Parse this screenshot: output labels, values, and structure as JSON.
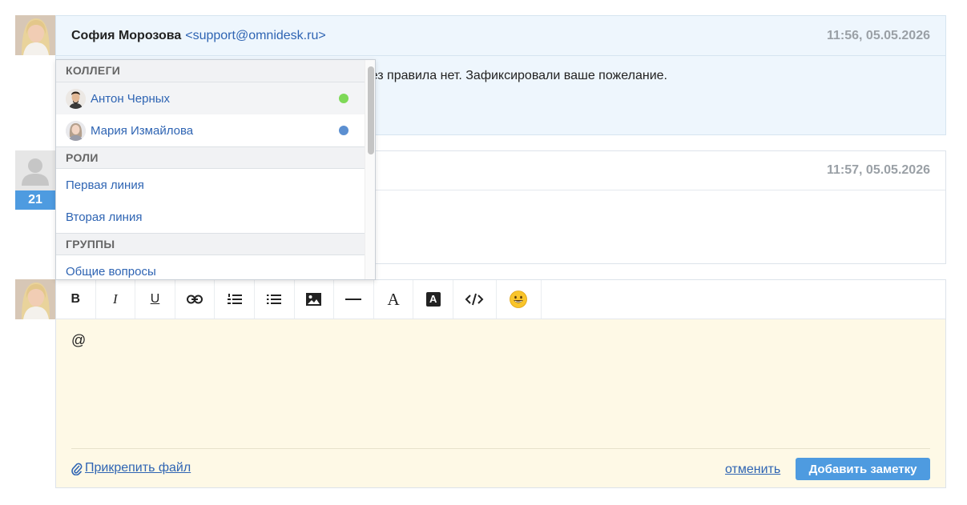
{
  "messages": [
    {
      "sender": "София Морозова",
      "email": "<support@omnidesk.ru>",
      "time": "11:56, 05.05.2026",
      "body_fragment": "ного через правила нет. Зафиксировали ваше пожелание."
    },
    {
      "time": "11:57, 05.05.2026",
      "badge": "21"
    }
  ],
  "dropdown": {
    "sections": [
      {
        "title": "КОЛЛЕГИ",
        "items": [
          {
            "label": "Антон Черных",
            "status_color": "#7ed957"
          },
          {
            "label": "Мария Измайлова",
            "status_color": "#5b8fd1"
          }
        ]
      },
      {
        "title": "РОЛИ",
        "items": [
          {
            "label": "Первая линия"
          },
          {
            "label": "Вторая линия"
          }
        ]
      },
      {
        "title": "ГРУППЫ",
        "items": [
          {
            "label": "Общие вопросы"
          }
        ]
      }
    ]
  },
  "toolbar": {
    "buttons": [
      "bold-icon",
      "italic-icon",
      "underline-icon",
      "link-icon",
      "ordered-list-icon",
      "bullet-list-icon",
      "image-icon",
      "horizontal-rule-icon",
      "font-color-icon",
      "background-color-icon",
      "code-icon",
      "emoji-icon"
    ],
    "bold_label": "B",
    "italic_label": "I",
    "underline_label": "U",
    "font_label": "A",
    "bg_label": "A"
  },
  "editor": {
    "value": "@",
    "attach_label": "Прикрепить файл",
    "cancel_label": "отменить",
    "submit_label": "Добавить заметку"
  },
  "colors": {
    "accent": "#4e9be0",
    "link": "#2e64b3",
    "note_bg": "#fef9e6",
    "message_bg": "#eef6fd"
  }
}
